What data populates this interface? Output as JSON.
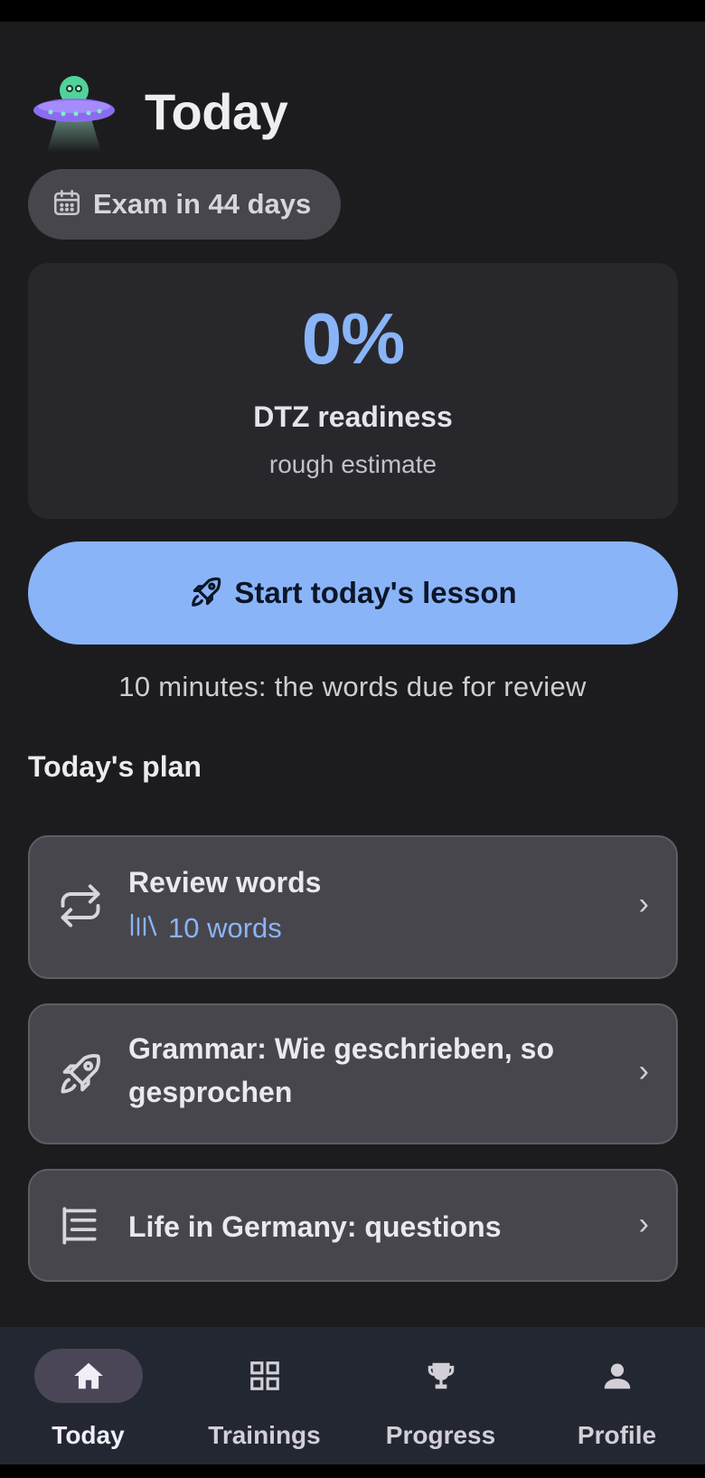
{
  "header": {
    "title": "Today",
    "logo_icon": "ufo-mascot-icon"
  },
  "exam_chip": {
    "label": "Exam in 44 days",
    "icon": "calendar-icon"
  },
  "readiness": {
    "value": "0%",
    "title": "DTZ readiness",
    "subtitle": "rough estimate",
    "accent": "#8ab4f8"
  },
  "start_button": {
    "label": "Start today's lesson",
    "icon": "rocket-icon",
    "subtitle": "10 minutes: the words due for review"
  },
  "plan": {
    "heading": "Today's plan",
    "items": [
      {
        "title": "Review words",
        "meta": "10 words",
        "icon": "repeat-icon",
        "meta_icon": "library-icon"
      },
      {
        "title": "Grammar: Wie geschrieben, so gesprochen",
        "icon": "rocket-icon"
      },
      {
        "title": "Life in Germany: questions",
        "icon": "list-icon"
      }
    ],
    "chevron": "›"
  },
  "nav": {
    "items": [
      {
        "label": "Today",
        "icon": "home-icon",
        "active": true
      },
      {
        "label": "Trainings",
        "icon": "grid-icon",
        "active": false
      },
      {
        "label": "Progress",
        "icon": "trophy-icon",
        "active": false
      },
      {
        "label": "Profile",
        "icon": "person-icon",
        "active": false
      }
    ]
  },
  "colors": {
    "background": "#1c1c1f",
    "card": "#48464d",
    "primary": "#8ab4f8",
    "nav_bg": "#222731"
  }
}
